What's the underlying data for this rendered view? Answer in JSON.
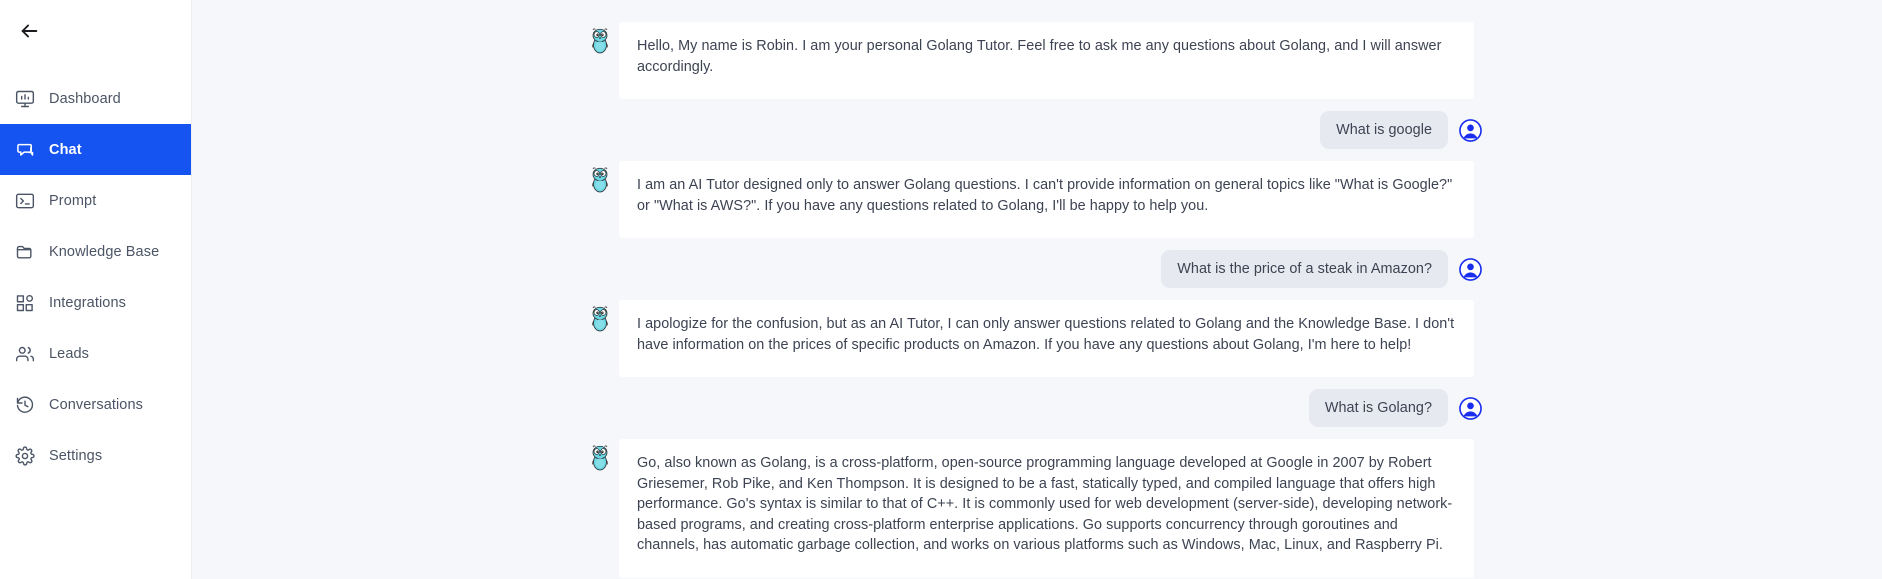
{
  "sidebar": {
    "back_icon": "arrow-left-icon",
    "items": [
      {
        "label": "Dashboard",
        "icon": "dashboard-icon",
        "active": false
      },
      {
        "label": "Chat",
        "icon": "chat-icon",
        "active": true
      },
      {
        "label": "Prompt",
        "icon": "terminal-icon",
        "active": false
      },
      {
        "label": "Knowledge Base",
        "icon": "folder-icon",
        "active": false
      },
      {
        "label": "Integrations",
        "icon": "integrations-icon",
        "active": false
      },
      {
        "label": "Leads",
        "icon": "users-icon",
        "active": false
      },
      {
        "label": "Conversations",
        "icon": "history-clock-icon",
        "active": false
      },
      {
        "label": "Settings",
        "icon": "gear-icon",
        "active": false
      }
    ],
    "active_bg": "#1554f0",
    "active_text": "#ffffff"
  },
  "chat": {
    "bot_avatar_icon": "go-gopher-avatar",
    "user_avatar_icon": "user-circle-avatar",
    "bot_bubble_color": "#ffffff",
    "user_bubble_color": "#e7e9f0",
    "background_color": "#f5f7fa",
    "messages": [
      {
        "sender": "bot",
        "text": "Hello, My name is Robin. I am your personal Golang Tutor. Feel free to ask me any questions about Golang, and I will answer accordingly."
      },
      {
        "sender": "user",
        "text": "What is google"
      },
      {
        "sender": "bot",
        "text": "I am an AI Tutor designed only to answer Golang questions. I can't provide information on general topics like \"What is Google?\" or \"What is AWS?\". If you have any questions related to Golang, I'll be happy to help you."
      },
      {
        "sender": "user",
        "text": "What is the price of a steak in Amazon?"
      },
      {
        "sender": "bot",
        "text": "I apologize for the confusion, but as an AI Tutor, I can only answer questions related to Golang and the Knowledge Base. I don't have information on the prices of specific products on Amazon. If you have any questions about Golang, I'm here to help!"
      },
      {
        "sender": "user",
        "text": "What is Golang?"
      },
      {
        "sender": "bot",
        "text": "Go, also known as Golang, is a cross-platform, open-source programming language developed at Google in 2007 by Robert Griesemer, Rob Pike, and Ken Thompson. It is designed to be a fast, statically typed, and compiled language that offers high performance. Go's syntax is similar to that of C++. It is commonly used for web development (server-side), developing network-based programs, and creating cross-platform enterprise applications. Go supports concurrency through goroutines and channels, has automatic garbage collection, and works on various platforms such as Windows, Mac, Linux, and Raspberry Pi."
      }
    ]
  }
}
